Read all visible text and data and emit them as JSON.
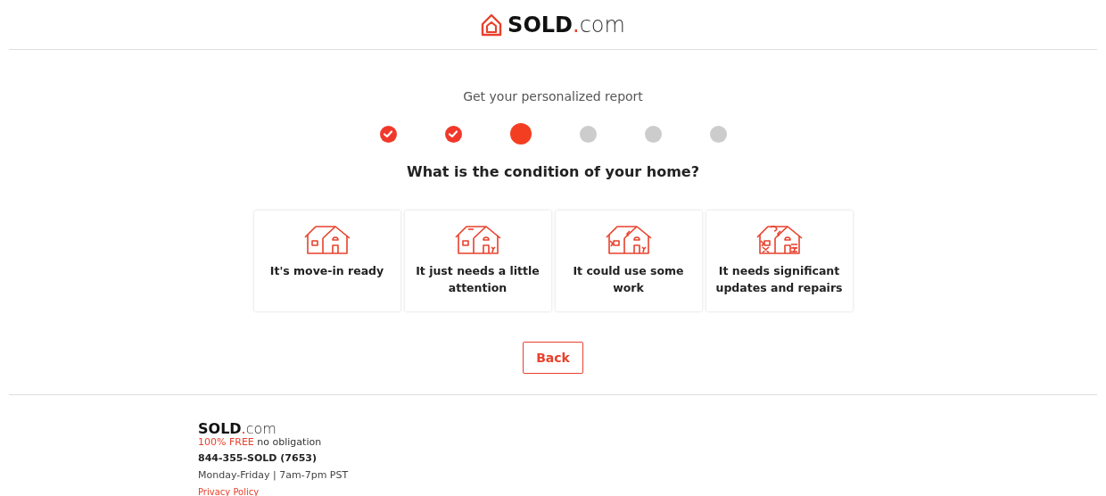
{
  "header": {
    "logo": {
      "brand": "SOLD",
      "dot": ".",
      "suffix": "com"
    }
  },
  "intro": "Get your personalized report",
  "steps": [
    {
      "completed": true,
      "selected": false
    },
    {
      "completed": true,
      "selected": false
    },
    {
      "completed": false,
      "selected": true
    },
    {
      "completed": false,
      "selected": false
    },
    {
      "completed": false,
      "selected": false
    },
    {
      "completed": false,
      "selected": false
    }
  ],
  "question": "What is the condition of your home?",
  "options": [
    {
      "label": "It's move-in ready",
      "kind": "intact"
    },
    {
      "label": "It just needs a little attention",
      "kind": "worn"
    },
    {
      "label": "It could use some work",
      "kind": "cracked"
    },
    {
      "label": "It needs significant updates and repairs",
      "kind": "damaged"
    }
  ],
  "back_button": "Back",
  "footer": {
    "logo": {
      "brand": "SOLD",
      "dot": ".",
      "suffix": "com"
    },
    "tagline_highlight": "100% FREE",
    "tagline_rest": "no obligation",
    "phone": "844-355-SOLD (7653)",
    "hours": "Monday-Friday | 7am-7pm PST",
    "privacy_link": "Privacy Policy"
  }
}
